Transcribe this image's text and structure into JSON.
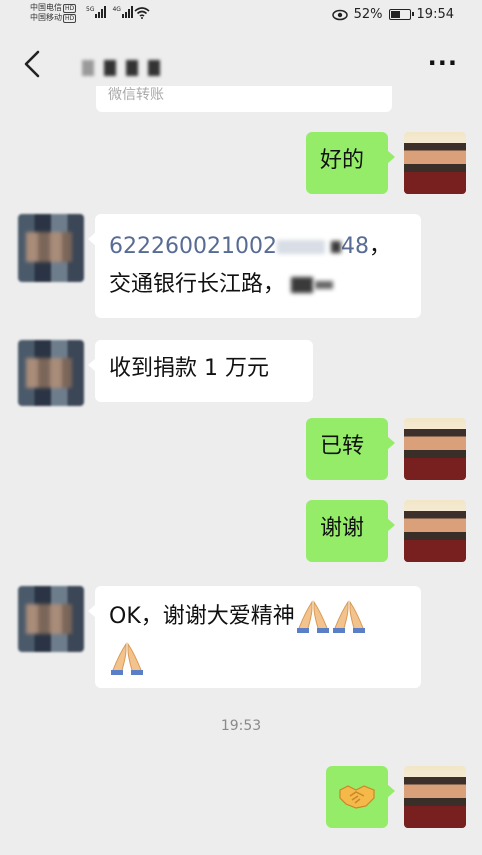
{
  "status": {
    "carrier1": "中国电信",
    "carrier2": "中国移动",
    "hd": "HD",
    "net1": "5G",
    "net2": "4G",
    "battery": "52%",
    "battery_level": 0.52,
    "time": "19:54"
  },
  "nav": {
    "back_icon": "chevron-left-icon",
    "more_label": "···"
  },
  "prev_message": "微信转账",
  "messages": [
    {
      "side": "out",
      "text": "好的"
    },
    {
      "side": "in",
      "link": "622260021002",
      "link_end": "48",
      "after": "，",
      "line2": "交通银行长江路，"
    },
    {
      "side": "in",
      "text": "收到捐款 1 万元"
    },
    {
      "side": "out",
      "text": "已转"
    },
    {
      "side": "out",
      "text": "谢谢"
    },
    {
      "side": "in",
      "text": "OK，谢谢大爱精神",
      "emoji": "praying-hands-icon"
    },
    {
      "side": "out",
      "emoji": "handshake-icon"
    }
  ],
  "timestamp": "19:53",
  "colors": {
    "sent_bubble": "#95ec69",
    "received_bubble": "#ffffff",
    "background": "#ededed",
    "link": "#576b95"
  }
}
